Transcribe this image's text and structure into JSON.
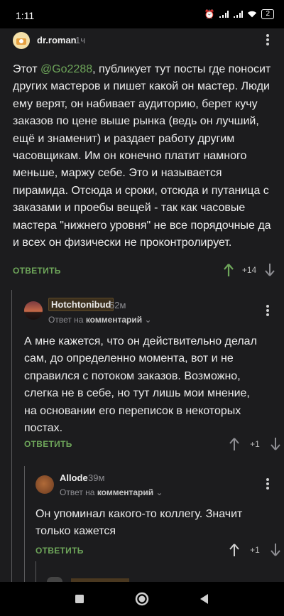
{
  "status": {
    "time": "1:11",
    "battery": "2"
  },
  "comment1": {
    "username": "dr.roman",
    "time_ago": "1ч",
    "text_prefix": "Этот ",
    "mention": "@Go2288",
    "text_suffix": ", публикует тут посты где поносит других мастеров и пишет какой он мастер. Люди ему верят, он набивает аудиторию, берет кучу заказов по цене выше рынка (ведь он лучший, ещё и знаменит) и раздает работу другим часовщикам. Им он конечно платит намного меньше, маржу себе. Это и называется пирамида. Отсюда и сроки, отсюда и путаница с заказами и проебы вещей - так как часовые мастера \"нижнего уровня\" не все порядочные да и всех он физически не проконтролирует.",
    "reply_label": "ОТВЕТИТЬ",
    "score": "+14"
  },
  "comment2": {
    "username": "Hotchtonibud",
    "time_ago": "52м",
    "reply_to_prefix": "Ответ на ",
    "reply_to_target": "комментарий",
    "text": "А мне кажется, что он действительно делал сам, до определенно момента, вот и не справился с потоком заказов. Возможно, слегка не в себе, но тут лишь мои мнение, на основании его переписок в некоторых постах.",
    "reply_label": "ОТВЕТИТЬ",
    "score": "+1"
  },
  "comment3": {
    "username": "Allode",
    "time_ago": "39м",
    "reply_to_prefix": "Ответ на ",
    "reply_to_target": "комментарий",
    "text": "Он упоминал какого-то коллегу. Значит только кажется",
    "reply_label": "ОТВЕТИТЬ",
    "score": "+1"
  },
  "colors": {
    "accent": "#6ea65a",
    "background": "#1c1c1e",
    "text": "#ececec",
    "muted": "#8e8e93"
  },
  "icons": [
    "wifi-icon",
    "signal-icon",
    "alarm-icon",
    "battery-icon",
    "kebab-menu-icon",
    "arrow-up-icon",
    "arrow-down-icon",
    "chevron-down-icon",
    "nav-recents-icon",
    "nav-home-icon",
    "nav-back-icon"
  ]
}
